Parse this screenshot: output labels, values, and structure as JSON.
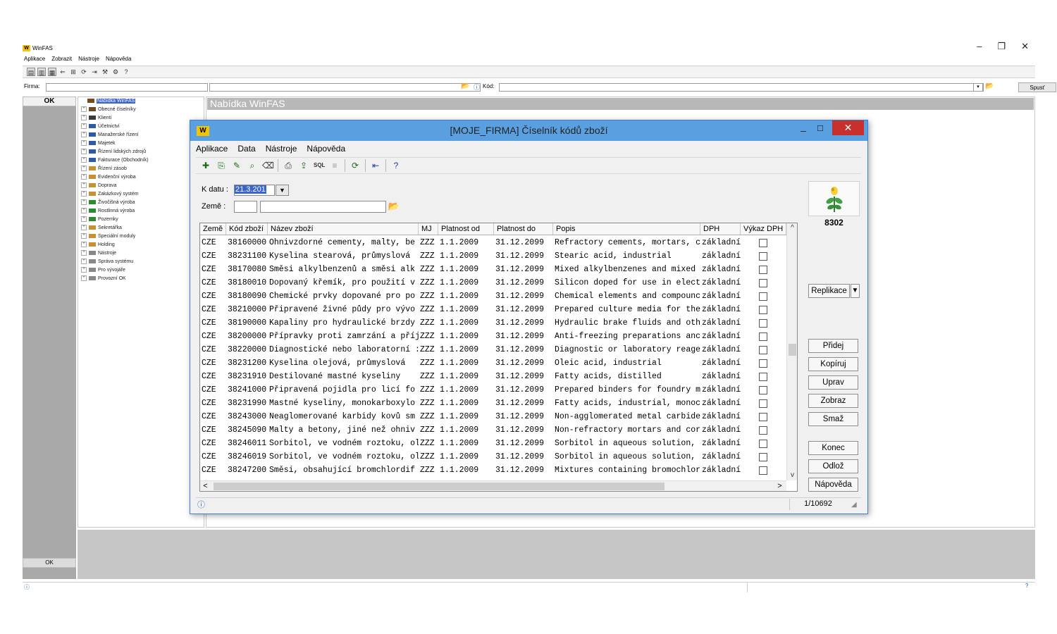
{
  "main": {
    "title": "WinFAS",
    "menu": [
      "Aplikace",
      "Zobrazit",
      "Nástroje",
      "Nápověda"
    ],
    "firma_label": "Firma:",
    "kod_label": "Kód:",
    "spust_label": "Spusť",
    "ok_top": "OK",
    "ok_bottom": "OK",
    "right_header": "Nabídka WinFAS",
    "tree": [
      {
        "label": "Nabídka WinFAS",
        "color": "#7a4a1e",
        "selected": true
      },
      {
        "label": "Obecné číselníky",
        "color": "#6b4a2a"
      },
      {
        "label": "Klienti",
        "color": "#3a3a3a"
      },
      {
        "label": "Účetnictví",
        "color": "#2d5aa8"
      },
      {
        "label": "Manažerské řízení",
        "color": "#2d5aa8"
      },
      {
        "label": "Majetek",
        "color": "#2d5aa8"
      },
      {
        "label": "Řízení lidských zdrojů",
        "color": "#2d5aa8"
      },
      {
        "label": "Fakturace (Obchodník)",
        "color": "#2d5aa8"
      },
      {
        "label": "Řízení zásob",
        "color": "#c89030"
      },
      {
        "label": "Evidenční výroba",
        "color": "#c89030"
      },
      {
        "label": "Doprava",
        "color": "#c89030"
      },
      {
        "label": "Zakázkový systém",
        "color": "#c89030"
      },
      {
        "label": "Živočišná výroba",
        "color": "#2e8a2e"
      },
      {
        "label": "Rostlinná výroba",
        "color": "#2e8a2e"
      },
      {
        "label": "Pozemky",
        "color": "#2e8a2e"
      },
      {
        "label": "Sekretářka",
        "color": "#c89030"
      },
      {
        "label": "Speciální moduly",
        "color": "#c89030"
      },
      {
        "label": "Holding",
        "color": "#c89030"
      },
      {
        "label": "Nástroje",
        "color": "#888888"
      },
      {
        "label": "Správa systému",
        "color": "#888888"
      },
      {
        "label": "Pro vývojáře",
        "color": "#888888"
      },
      {
        "label": "Provozní OK",
        "color": "#888888"
      }
    ]
  },
  "dialog": {
    "title": "[MOJE_FIRMA] Číselník kódů zboží",
    "menu": [
      "Aplikace",
      "Data",
      "Nástroje",
      "Nápověda"
    ],
    "kdatu_label": "K datu :",
    "kdatu_value": "21.3.201",
    "zeme_label": "Země :",
    "logo_number": "8302",
    "columns": [
      "Země",
      "Kód zboží",
      "Název zboží",
      "MJ",
      "Platnost od",
      "Platnost do",
      "Popis",
      "DPH",
      "Výkaz DPH"
    ],
    "rows": [
      [
        "CZE",
        "38160000",
        "Ohnivzdorné cementy, malty, be",
        "ZZZ",
        "1.1.2009",
        "31.12.2099",
        "Refractory cements, mortars, c",
        "základní"
      ],
      [
        "CZE",
        "38231100",
        "Kyselina stearová, průmyslová",
        "ZZZ",
        "1.1.2009",
        "31.12.2099",
        "Stearic acid, industrial",
        "základní"
      ],
      [
        "CZE",
        "38170080",
        "Směsi alkylbenzenů a směsi alk",
        "ZZZ",
        "1.1.2009",
        "31.12.2099",
        "Mixed alkylbenzenes and mixed",
        "základní"
      ],
      [
        "CZE",
        "38180010",
        "Dopovaný křemík, pro použití v",
        "ZZZ",
        "1.1.2009",
        "31.12.2099",
        "Silicon doped for use in elect",
        "základní"
      ],
      [
        "CZE",
        "38180090",
        "Chemické prvky dopované pro po",
        "ZZZ",
        "1.1.2009",
        "31.12.2099",
        "Chemical elements and compounc",
        "základní"
      ],
      [
        "CZE",
        "38210000",
        "Připravené živné půdy pro vývo",
        "ZZZ",
        "1.1.2009",
        "31.12.2099",
        "Prepared culture media for the",
        "základní"
      ],
      [
        "CZE",
        "38190000",
        "Kapaliny pro hydraulické brzdy",
        "ZZZ",
        "1.1.2009",
        "31.12.2099",
        "Hydraulic brake fluids and oth",
        "základní"
      ],
      [
        "CZE",
        "38200000",
        "Přípravky proti zamrzání a příj",
        "ZZZ",
        "1.1.2009",
        "31.12.2099",
        "Anti-freezing preparations anc",
        "základní"
      ],
      [
        "CZE",
        "38220000",
        "Diagnostické nebo laboratorní :",
        "ZZZ",
        "1.1.2009",
        "31.12.2099",
        "Diagnostic or laboratory reage",
        "základní"
      ],
      [
        "CZE",
        "38231200",
        "Kyselina olejová, průmyslová",
        "ZZZ",
        "1.1.2009",
        "31.12.2099",
        "Oleic acid, industrial",
        "základní"
      ],
      [
        "CZE",
        "38231910",
        "Destilované mastné kyseliny",
        "ZZZ",
        "1.1.2009",
        "31.12.2099",
        "Fatty acids, distilled",
        "základní"
      ],
      [
        "CZE",
        "38241000",
        "Připravená pojidla pro licí fo",
        "ZZZ",
        "1.1.2009",
        "31.12.2099",
        "Prepared binders for foundry m",
        "základní"
      ],
      [
        "CZE",
        "38231990",
        "Mastné kyseliny, monokarboxylo",
        "ZZZ",
        "1.1.2009",
        "31.12.2099",
        "Fatty acids, industrial, monoc",
        "základní"
      ],
      [
        "CZE",
        "38243000",
        "Neaglomerované karbidy kovů sm",
        "ZZZ",
        "1.1.2009",
        "31.12.2099",
        "Non-agglomerated metal carbide",
        "základní"
      ],
      [
        "CZE",
        "38245090",
        "Malty a betony, jiné než ohniv",
        "ZZZ",
        "1.1.2009",
        "31.12.2099",
        "Non-refractory mortars and cor",
        "základní"
      ],
      [
        "CZE",
        "38246011",
        "Sorbitol, ve vodném roztoku, ol",
        "ZZZ",
        "1.1.2009",
        "31.12.2099",
        "Sorbitol in aqueous solution,",
        "základní"
      ],
      [
        "CZE",
        "38246019",
        "Sorbitol, ve vodném roztoku, ol",
        "ZZZ",
        "1.1.2009",
        "31.12.2099",
        "Sorbitol in aqueous solution,",
        "základní"
      ],
      [
        "CZE",
        "38247200",
        "Směsi, obsahující bromchlordif",
        "ZZZ",
        "1.1.2009",
        "31.12.2099",
        "Mixtures containing bromochlor",
        "základní"
      ]
    ],
    "buttons": {
      "replikace": "Replikace",
      "pridej": "Přidej",
      "kopiruj": "Kopíruj",
      "uprav": "Uprav",
      "zobraz": "Zobraz",
      "smaz": "Smaž",
      "konec": "Konec",
      "odloz": "Odlož",
      "napoveda": "Nápověda"
    },
    "record_count": "1/10692"
  }
}
